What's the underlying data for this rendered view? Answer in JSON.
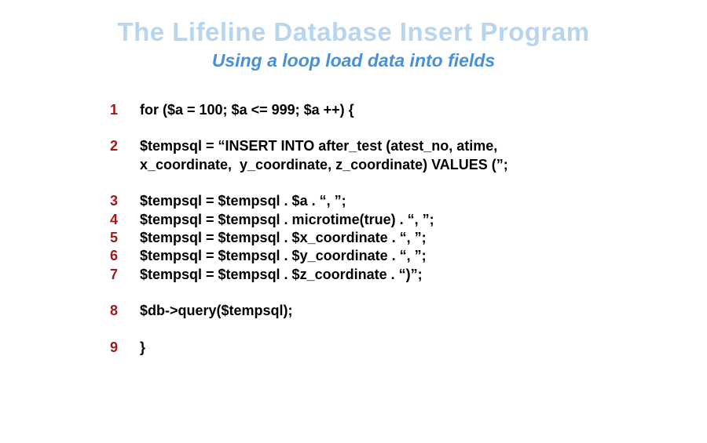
{
  "title": "The Lifeline Database Insert Program",
  "subtitle": "Using a loop load data into fields",
  "lines": {
    "n1": "1",
    "c1": "for ($a = 100; $a <= 999; $a ++) {",
    "n2": "2",
    "c2a": "$tempsql = “INSERT INTO after_test (atest_no, atime,",
    "c2b": "x_coordinate,  y_coordinate, z_coordinate) VALUES (”;",
    "n3": "3",
    "c3": "$tempsql = $tempsql . $a . “, ”;",
    "n4": "4",
    "c4": "$tempsql = $tempsql . microtime(true) . “, ”;",
    "n5": "5",
    "c5": "$tempsql = $tempsql . $x_coordinate . “, ”;",
    "n6": "6",
    "c6": "$tempsql = $tempsql . $y_coordinate . “, ”;",
    "n7": "7",
    "c7": "$tempsql = $tempsql . $z_coordinate . “)”;",
    "n8": "8",
    "c8": "$db->query($tempsql);",
    "n9": "9",
    "c9": "}"
  }
}
